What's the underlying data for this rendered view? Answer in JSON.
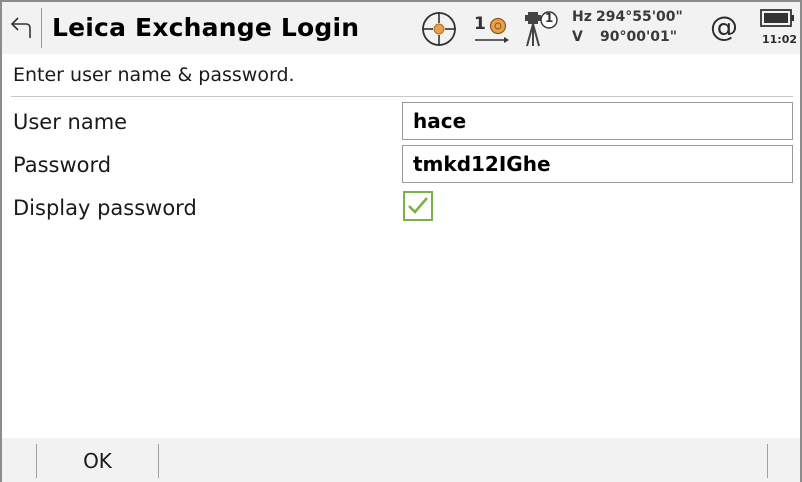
{
  "header": {
    "title": "Leica Exchange Login",
    "prism_count": "1",
    "instrument_badge": "1",
    "angles": {
      "hz_label": "Hz",
      "hz_value": "294°55'00\"",
      "v_label": "V",
      "v_value": "90°00'01\""
    },
    "at_symbol": "@",
    "clock": "11:02"
  },
  "main": {
    "prompt": "Enter user name & password.",
    "fields": [
      {
        "label": "User name",
        "value": "hace"
      },
      {
        "label": "Password",
        "value": "tmkd12IGhe"
      }
    ],
    "display_password": {
      "label": "Display password",
      "checked": true
    }
  },
  "softkeys": {
    "ok_label": "OK"
  },
  "colors": {
    "accent_orange": "#e8a04a",
    "check_green": "#7bb04d",
    "bar_gray": "#f2f2f2"
  }
}
